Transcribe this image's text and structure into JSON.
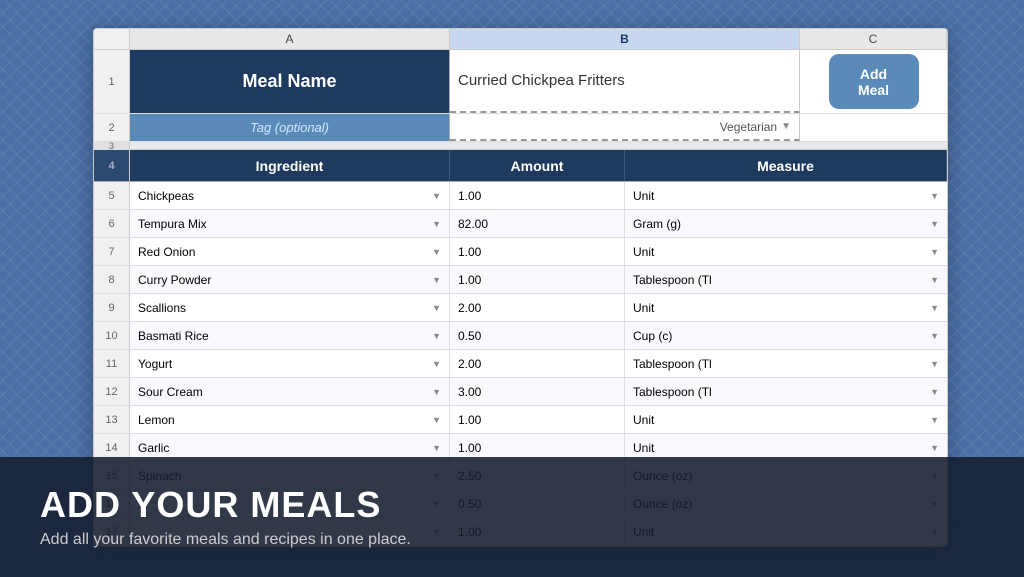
{
  "background": {
    "color": "#4a6fa5"
  },
  "spreadsheet": {
    "col_headers": [
      "",
      "A",
      "B",
      "C"
    ],
    "row1": {
      "num": "1",
      "label": "Meal Name",
      "value": "Curried Chickpea Fritters",
      "btn": "Add Meal"
    },
    "row2": {
      "num": "2",
      "label": "Tag (optional)",
      "value": "Vegetarian"
    },
    "row3": {
      "num": "3"
    },
    "row4": {
      "num": "4",
      "col1": "Ingredient",
      "col2": "Amount",
      "col3": "Measure"
    },
    "ingredients": [
      {
        "num": "5",
        "name": "Chickpeas",
        "amount": "1.00",
        "measure": "Unit"
      },
      {
        "num": "6",
        "name": "Tempura Mix",
        "amount": "82.00",
        "measure": "Gram (g)"
      },
      {
        "num": "7",
        "name": "Red Onion",
        "amount": "1.00",
        "measure": "Unit"
      },
      {
        "num": "8",
        "name": "Curry Powder",
        "amount": "1.00",
        "measure": "Tablespoon (Tl"
      },
      {
        "num": "9",
        "name": "Scallions",
        "amount": "2.00",
        "measure": "Unit"
      },
      {
        "num": "10",
        "name": "Basmati Rice",
        "amount": "0.50",
        "measure": "Cup (c)"
      },
      {
        "num": "11",
        "name": "Yogurt",
        "amount": "2.00",
        "measure": "Tablespoon (Tl"
      },
      {
        "num": "12",
        "name": "Sour Cream",
        "amount": "3.00",
        "measure": "Tablespoon (Tl"
      },
      {
        "num": "13",
        "name": "Lemon",
        "amount": "1.00",
        "measure": "Unit"
      },
      {
        "num": "14",
        "name": "Garlic",
        "amount": "1.00",
        "measure": "Unit"
      },
      {
        "num": "15",
        "name": "Spinach",
        "amount": "2.50",
        "measure": "Ounce (oz)"
      },
      {
        "num": "16",
        "name": "...",
        "amount": "0.50",
        "measure": "Ounce (oz)"
      },
      {
        "num": "17",
        "name": "...",
        "amount": "1.00",
        "measure": "Unit"
      }
    ]
  },
  "overlay": {
    "title": "ADD YOUR MEALS",
    "subtitle": "Add all your favorite meals and recipes in one place."
  }
}
